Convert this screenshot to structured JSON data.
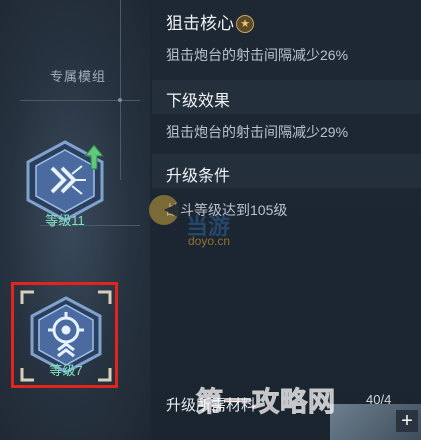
{
  "module_panel": {
    "label": "专属模组",
    "modules": [
      {
        "level_label": "等级11",
        "icon": "chevron-burst-icon",
        "upgrade_indicator": "up-arrow-icon"
      },
      {
        "level_label": "等级7",
        "icon": "crosshair-icon",
        "selected": true
      }
    ]
  },
  "detail_panel": {
    "title": "狙击核心",
    "title_badge": "★",
    "current_effect": "狙击炮台的射击间隔减少26%",
    "next_level": {
      "heading": "下级效果",
      "effect": "狙击炮台的射击间隔减少29%"
    },
    "upgrade_condition": {
      "heading": "升级条件",
      "requirement": "战斗等级达到105级"
    },
    "materials": {
      "label": "升级所需材料",
      "count": "40/4",
      "add_label": "+"
    }
  },
  "watermarks": {
    "site_logo_text": "当游",
    "site_url": "doyo.cn",
    "corner_brand": "第一攻略网"
  },
  "colors": {
    "selection_border": "#e3241d",
    "level_text": "#7fe3c2",
    "upgrade_arrow": "#5fc97a",
    "hex_fill": "#3f5d88",
    "hex_border": "#8fb2d8"
  }
}
